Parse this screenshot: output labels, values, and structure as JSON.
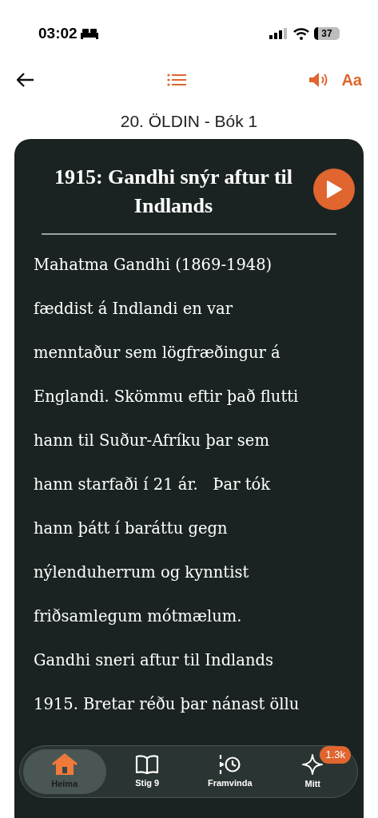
{
  "status_bar": {
    "time": "03:02",
    "battery": "37"
  },
  "header": {
    "subtitle": "20. ÖLDIN - Bók 1",
    "font_button": "Aa"
  },
  "article": {
    "title": "1915: Gandhi snýr aftur til Indlands",
    "lines": [
      "Mahatma Gandhi (1869-1948)",
      "fæddist á Indlandi en var",
      "menntaður sem lögfræðingur á",
      "Englandi. Skömmu eftir það flutti",
      "hann til Suður-Afríku þar sem",
      "hann starfaði í 21 ár.   Þar tók",
      "hann þátt í baráttu gegn",
      "nýlenduherrum og kynntist",
      "friðsamlegum mótmælum.",
      "Gandhi sneri aftur til Indlands",
      "1915. Bretar réðu þar nánast öllu"
    ]
  },
  "tab_bar": [
    {
      "kind": "home",
      "label": "Heima",
      "selected": true
    },
    {
      "kind": "book",
      "label": "Stig 9",
      "selected": false
    },
    {
      "kind": "progress",
      "label": "Framvinda",
      "selected": false
    },
    {
      "kind": "sparkle",
      "label": "Mitt",
      "selected": false,
      "badge": "1.3k"
    }
  ]
}
